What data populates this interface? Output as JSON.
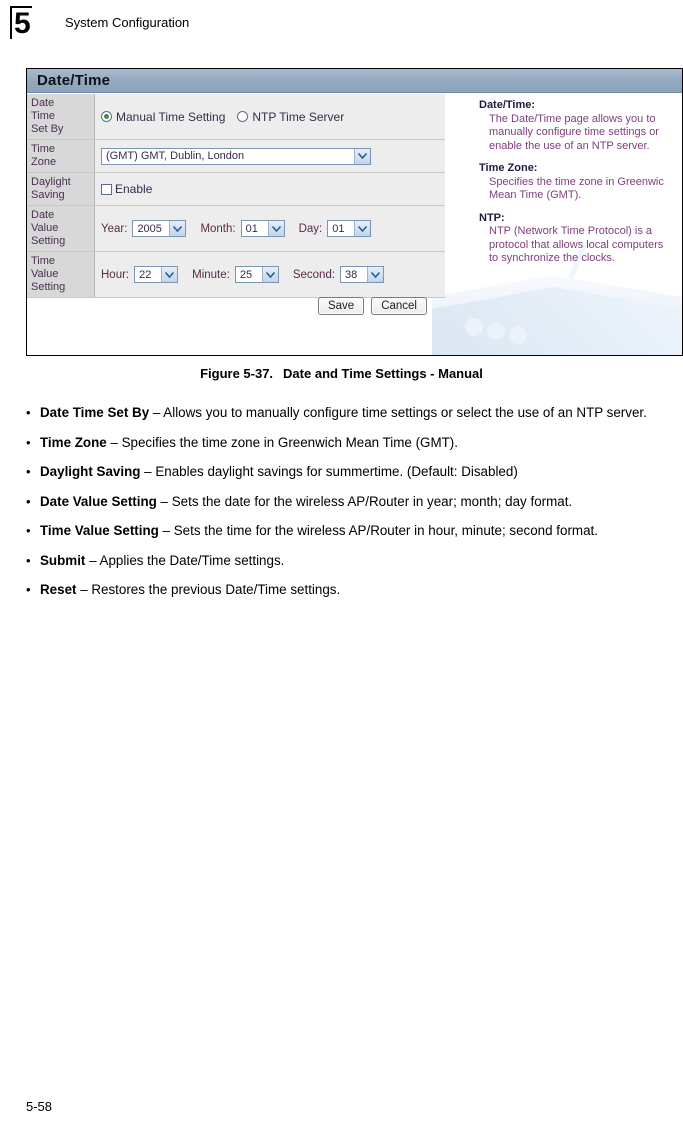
{
  "header": {
    "chapter_number": "5",
    "chapter_title": "System Configuration"
  },
  "figure": {
    "panel_title": "Date/Time",
    "rows": [
      {
        "label": "Date\nTime\nSet By",
        "label_lines": [
          "Date",
          "Time",
          "Set By"
        ]
      },
      {
        "label_lines": [
          "Time",
          "Zone"
        ]
      },
      {
        "label_lines": [
          "Daylight",
          "Saving"
        ]
      },
      {
        "label_lines": [
          "Date",
          "Value",
          "Setting"
        ]
      },
      {
        "label_lines": [
          "Time",
          "Value",
          "Setting"
        ]
      }
    ],
    "set_by": {
      "manual_label": "Manual Time Setting",
      "manual_selected": true,
      "ntp_label": "NTP Time Server",
      "ntp_selected": false
    },
    "time_zone": {
      "value": "(GMT) GMT, Dublin, London"
    },
    "daylight_saving": {
      "checkbox_label": "Enable",
      "checked": false
    },
    "date_value": {
      "year_label": "Year:",
      "year_value": "2005",
      "month_label": "Month:",
      "month_value": "01",
      "day_label": "Day:",
      "day_value": "01"
    },
    "time_value": {
      "hour_label": "Hour:",
      "hour_value": "22",
      "minute_label": "Minute:",
      "minute_value": "25",
      "second_label": "Second:",
      "second_value": "38"
    },
    "buttons": {
      "save": "Save",
      "cancel": "Cancel"
    },
    "help": [
      {
        "heading": "Date/Time:",
        "lines": [
          "The Date/Time page allows you to",
          "manually configure time settings or",
          "enable the use of an NTP server."
        ]
      },
      {
        "heading": "Time Zone:",
        "lines": [
          "Specifies the time zone in Greenwic",
          "Mean Time (GMT)."
        ]
      },
      {
        "heading": "NTP:",
        "lines": [
          "NTP (Network Time Protocol) is a",
          "protocol that allows local computers",
          "to synchronize the clocks."
        ]
      }
    ]
  },
  "caption": {
    "number": "Figure 5-37.",
    "title": "Date and Time Settings - Manual"
  },
  "bullets": [
    {
      "marker": "•",
      "term": "Date Time Set By",
      "description": " – Allows you to manually configure time settings or select the use of an NTP server."
    },
    {
      "marker": "•",
      "term": "Time Zone",
      "description": " – Specifies the time zone in Greenwich Mean Time (GMT)."
    },
    {
      "marker": "•",
      "term": "Daylight Saving",
      "description": " – Enables daylight savings for summertime. (Default: Disabled)"
    },
    {
      "marker": "•",
      "term": "Date Value Setting",
      "description": " – Sets the date for the wireless AP/Router in year; month; day format."
    },
    {
      "marker": "•",
      "term": "Time Value Setting",
      "description": " – Sets the time for the wireless AP/Router in hour, minute; second format."
    },
    {
      "marker": "•",
      "term": "Submit",
      "description": " – Applies the Date/Time settings."
    },
    {
      "marker": "•",
      "term": "Reset",
      "description": " – Restores the previous Date/Time settings."
    }
  ],
  "footer": {
    "page_number": "5-58"
  },
  "colors": {
    "title_bar": "#91a8c0",
    "label_cell": "#d8d8d8",
    "field_cell": "#ededed",
    "help_text": "#7d3f7d",
    "radio_on": "#3d8b3d"
  }
}
